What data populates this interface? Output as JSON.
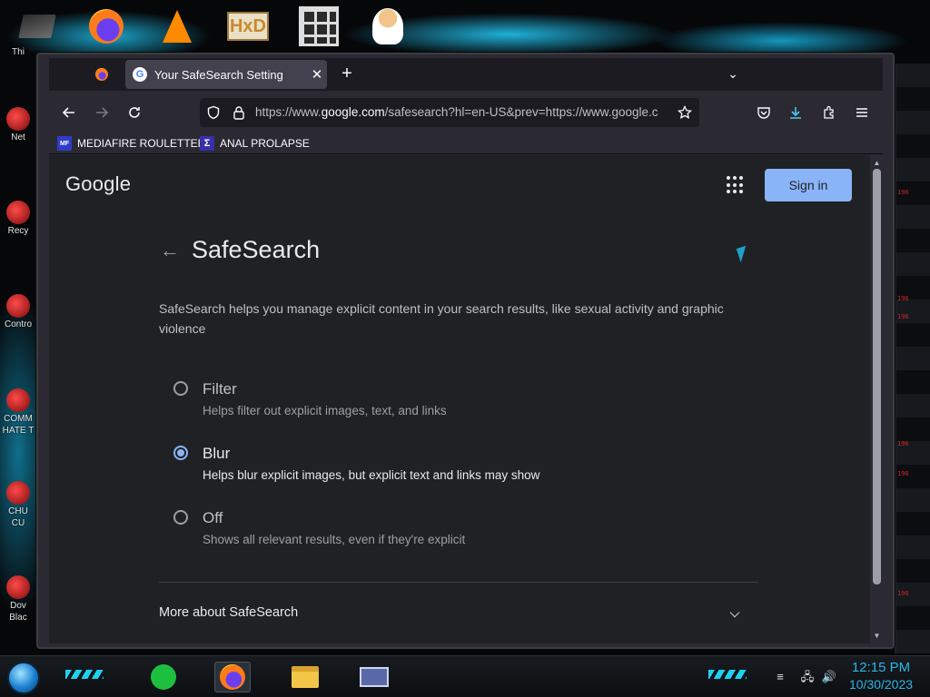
{
  "desktop": {
    "left_icons": [
      {
        "label": "Thi"
      },
      {
        "label": "Net"
      },
      {
        "label": "Recy"
      },
      {
        "label": "Contro"
      },
      {
        "label": "COMM"
      },
      {
        "label": "HATE T"
      },
      {
        "label": "CHU"
      },
      {
        "label": "CU"
      },
      {
        "label": "Dov"
      },
      {
        "label": "Blac"
      }
    ],
    "top_icons": [
      "thin-icon",
      "firefox-icon",
      "vlc-icon",
      "hxd-icon",
      "maze-icon",
      "doctor-icon"
    ],
    "hxd_text": "HxD",
    "hud_marks": [
      "196",
      "196",
      "196",
      "196",
      "196",
      "196"
    ]
  },
  "browser": {
    "tab": {
      "title": "Your SafeSearch Setting",
      "favicon": "G"
    },
    "url": {
      "prefix": "https://www.",
      "host": "google.com",
      "rest": "/safesearch?hl=en-US&prev=https://www.google.c"
    },
    "bookmarks": [
      {
        "label": "MEDIAFIRE ROULETTER",
        "badge": "MF"
      },
      {
        "label": "ANAL PROLAPSE",
        "badge": "Σ"
      }
    ]
  },
  "page": {
    "logo": "Google",
    "signin_label": "Sign in",
    "title": "SafeSearch",
    "description": "SafeSearch helps you manage explicit content in your search results, like sexual activity and graphic violence",
    "options": [
      {
        "label": "Filter",
        "sub": "Helps filter out explicit images, text, and links",
        "selected": false
      },
      {
        "label": "Blur",
        "sub": "Helps blur explicit images, but explicit text and links may show",
        "selected": true
      },
      {
        "label": "Off",
        "sub": "Shows all relevant results, even if they're explicit",
        "selected": false
      }
    ],
    "more_label": "More about SafeSearch"
  },
  "taskbar": {
    "time": "12:15 PM",
    "date": "10/30/2023"
  },
  "colors": {
    "accent": "#8ab4f8",
    "page_bg": "#202124",
    "clock": "#29b6e8"
  }
}
